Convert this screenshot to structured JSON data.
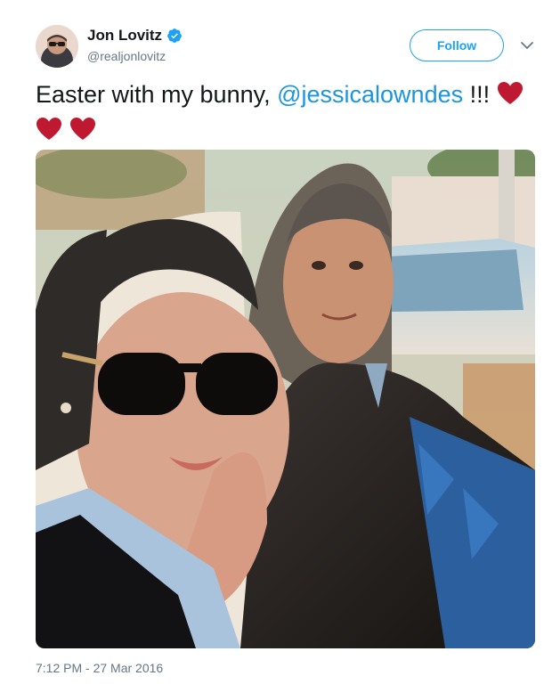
{
  "user": {
    "display_name": "Jon Lovitz",
    "handle": "@realjonlovitz",
    "verified": true,
    "avatar_icon": "profile-photo"
  },
  "actions": {
    "follow_label": "Follow",
    "more_icon": "chevron-down-icon"
  },
  "tweet": {
    "text_before": "Easter with my bunny, ",
    "mention": "@jessicalowndes",
    "text_after": " !!!",
    "hearts": 3,
    "heart_color": "#be1931"
  },
  "media": {
    "alt": "Selfie of a woman in sunglasses and a man in a leather jacket sitting in a convertible",
    "type": "photo"
  },
  "timestamp": "7:12 PM - 27 Mar 2016",
  "colors": {
    "accent": "#1da1f2",
    "mention": "#1b95e0",
    "secondary_text": "#657786",
    "primary_text": "#14171a"
  }
}
